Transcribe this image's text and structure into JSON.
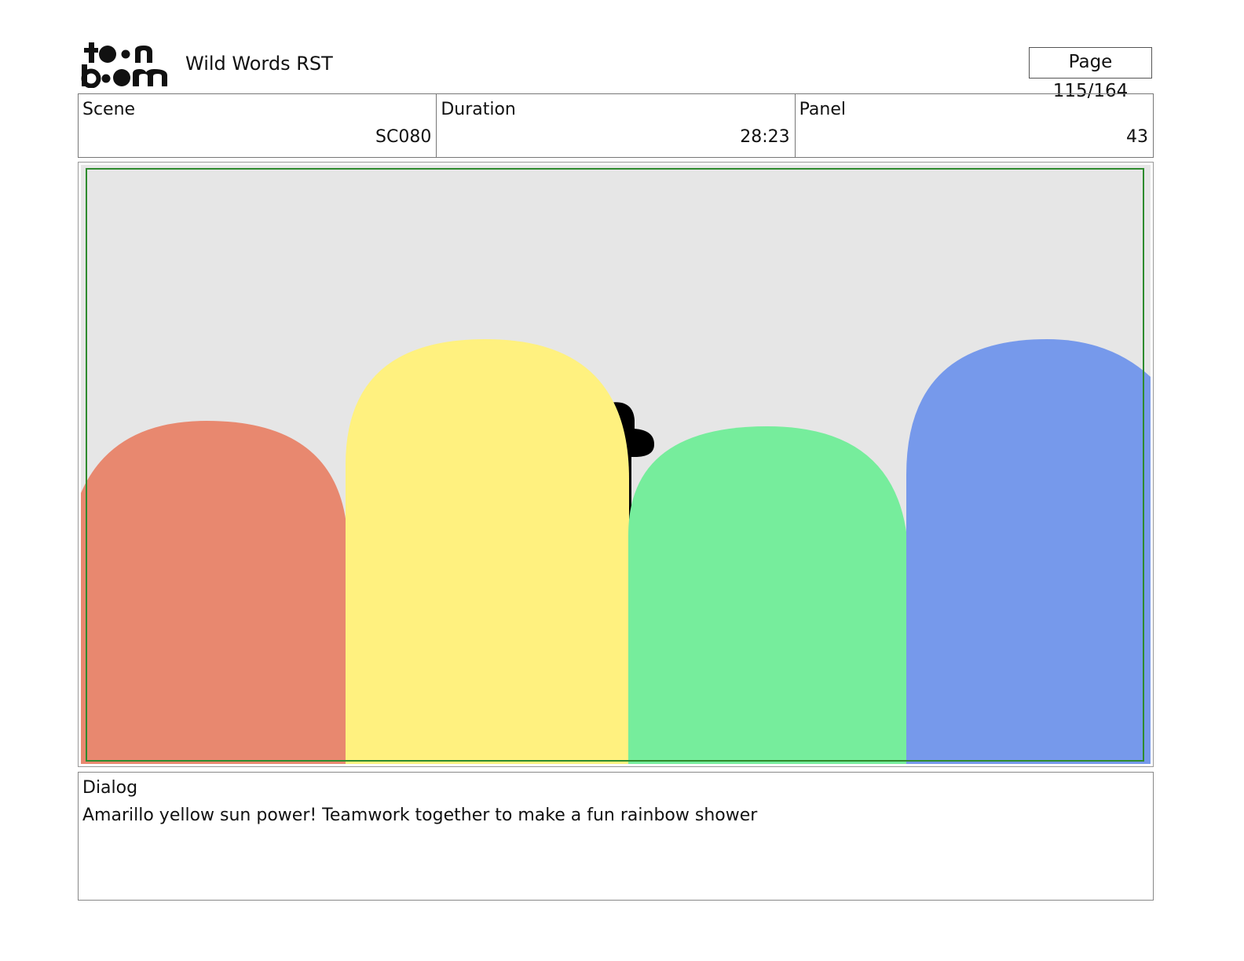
{
  "header": {
    "logo_text": "toonboom",
    "project_title": "Wild Words RST",
    "page_indicator": "Page 115/164"
  },
  "info": {
    "scene_label": "Scene",
    "scene_value": "SC080",
    "duration_label": "Duration",
    "duration_value": "28:23",
    "panel_label": "Panel",
    "panel_value": "43"
  },
  "panel": {
    "background_color": "#e6e6e6",
    "safe_frame_color": "#2e8b2e",
    "shapes": [
      {
        "name": "red-shape",
        "color": "#e8886f"
      },
      {
        "name": "yellow-shape",
        "color": "#fff17f"
      },
      {
        "name": "green-shape",
        "color": "#76ed9c"
      },
      {
        "name": "blue-shape",
        "color": "#7699eb"
      }
    ]
  },
  "dialog": {
    "label": "Dialog",
    "text": "Amarillo yellow sun power! Teamwork together to make a fun rainbow shower"
  }
}
